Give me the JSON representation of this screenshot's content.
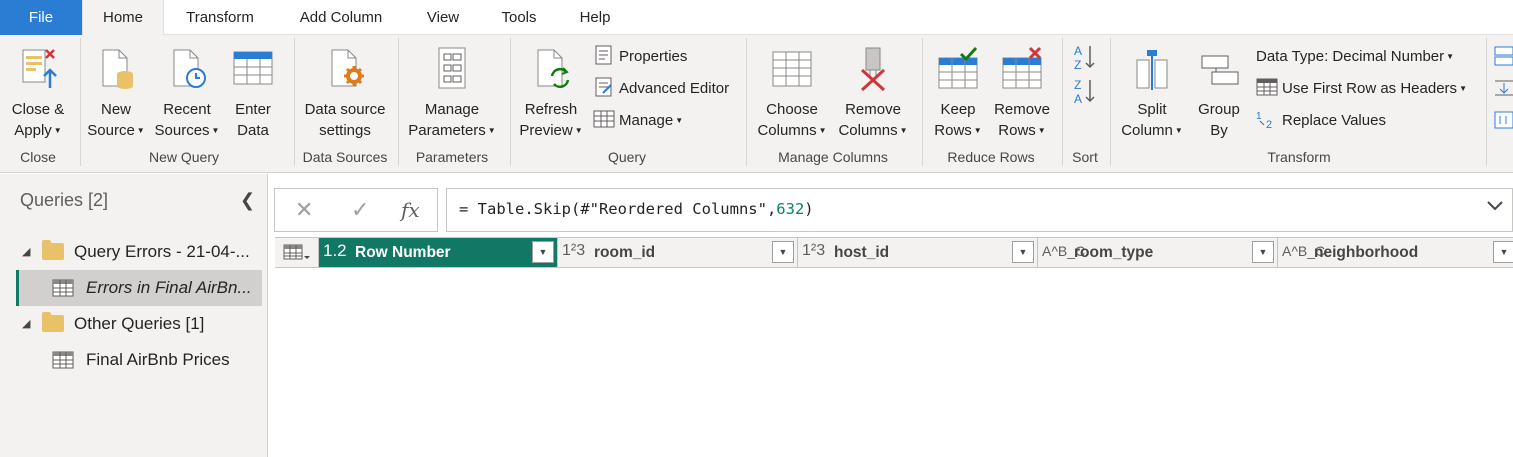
{
  "tabs": [
    "File",
    "Home",
    "Transform",
    "Add Column",
    "View",
    "Tools",
    "Help"
  ],
  "ribbon": {
    "close_group": {
      "close_apply_1": "Close &",
      "close_apply_2": "Apply",
      "label": "Close"
    },
    "newquery_group": {
      "new_source_1": "New",
      "new_source_2": "Source",
      "recent_sources_1": "Recent",
      "recent_sources_2": "Sources",
      "enter_data_1": "Enter",
      "enter_data_2": "Data",
      "label": "New Query"
    },
    "datasources_group": {
      "btn_1": "Data source",
      "btn_2": "settings",
      "label": "Data Sources"
    },
    "parameters_group": {
      "btn_1": "Manage",
      "btn_2": "Parameters",
      "label": "Parameters"
    },
    "query_group": {
      "refresh_1": "Refresh",
      "refresh_2": "Preview",
      "properties": "Properties",
      "advanced_editor": "Advanced Editor",
      "manage": "Manage",
      "label": "Query"
    },
    "managecols_group": {
      "choose_1": "Choose",
      "choose_2": "Columns",
      "remove_1": "Remove",
      "remove_2": "Columns",
      "label": "Manage Columns"
    },
    "reducerows_group": {
      "keep_1": "Keep",
      "keep_2": "Rows",
      "remove_1": "Remove",
      "remove_2": "Rows",
      "label": "Reduce Rows"
    },
    "sort_group": {
      "label": "Sort"
    },
    "transform_group": {
      "split_1": "Split",
      "split_2": "Column",
      "group_1": "Group",
      "group_2": "By",
      "data_type": "Data Type: Decimal Number",
      "first_row": "Use First Row as Headers",
      "replace": "Replace Values",
      "label": "Transform"
    }
  },
  "queries_pane": {
    "title": "Queries [2]",
    "folder1": "Query Errors - 21-04-...",
    "item_selected": "Errors in Final AirBn...",
    "folder2": "Other Queries [1]",
    "item2": "Final AirBnb Prices"
  },
  "formula": {
    "prefix": "= Table.Skip(#\"Reordered Columns\",",
    "number": "632",
    "suffix": ")"
  },
  "columns": [
    {
      "type": "1.2",
      "name": "Row Number"
    },
    {
      "type": "1²3",
      "name": "room_id"
    },
    {
      "type": "1²3",
      "name": "host_id"
    },
    {
      "type": "A^B_C",
      "name": "room_type"
    },
    {
      "type": "A^B_C",
      "name": "neighborhood"
    }
  ],
  "colors": {
    "accent": "#117865",
    "file_tab": "#2b7cd3"
  }
}
